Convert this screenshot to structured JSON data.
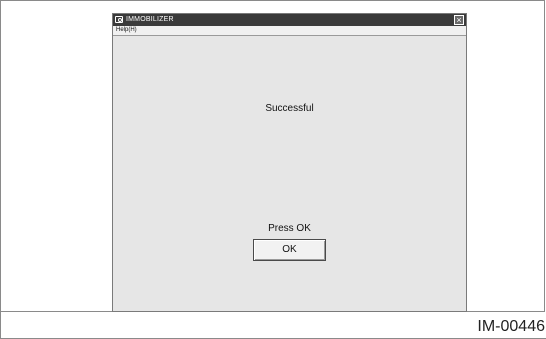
{
  "window": {
    "title": "IMMOBILIZER",
    "close_glyph": "×"
  },
  "menu": {
    "help_label": "Help(H)"
  },
  "messages": {
    "success": "Successful",
    "press": "Press OK"
  },
  "buttons": {
    "ok_label": "OK"
  },
  "figure": {
    "id_label": "IM-00446"
  },
  "icons": {
    "title_icon": "app-icon",
    "close_icon": "close-icon"
  },
  "colors": {
    "title_bar": "#3a3a3a",
    "window_bg": "#e6e6e6"
  }
}
